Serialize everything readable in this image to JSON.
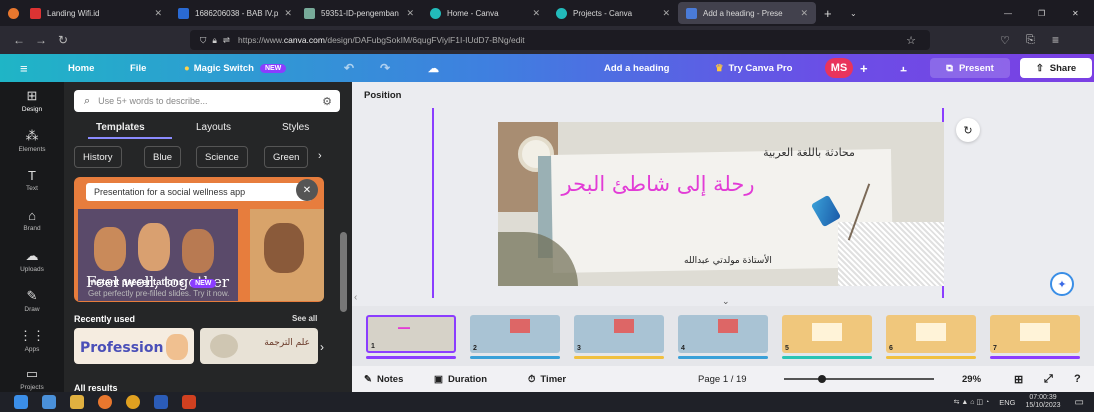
{
  "browser": {
    "tabs": [
      {
        "title": "Landing Wifi.id",
        "color": "#d33"
      },
      {
        "title": "1686206038 - BAB IV.p",
        "color": "#2a6ad4"
      },
      {
        "title": "59351-ID-pengemban",
        "color": "#7a9"
      },
      {
        "title": "Home - Canva",
        "color": "#2bb"
      },
      {
        "title": "Projects - Canva",
        "color": "#2bb"
      },
      {
        "title": "Add a heading - Prese",
        "color": "#4a7bd8"
      }
    ],
    "url_prefix": "https://www.",
    "url_domain": "canva.com",
    "url_path": "/design/DAFubgSokIM/6qugFViylF1I-IUdD7-BNg/edit"
  },
  "canva": {
    "home": "Home",
    "file": "File",
    "magic_switch": "Magic Switch",
    "new_badge": "NEW",
    "doc_title": "Add a heading",
    "try_pro": "Try Canva Pro",
    "avatar": "MS",
    "present": "Present",
    "share": "Share"
  },
  "rail": [
    {
      "label": "Design",
      "icon": "design-icon",
      "glyph": "⊞"
    },
    {
      "label": "Elements",
      "icon": "elements-icon",
      "glyph": "⁂"
    },
    {
      "label": "Text",
      "icon": "text-icon",
      "glyph": "T"
    },
    {
      "label": "Brand",
      "icon": "brand-icon",
      "glyph": "⌂"
    },
    {
      "label": "Uploads",
      "icon": "uploads-icon",
      "glyph": "☁"
    },
    {
      "label": "Draw",
      "icon": "draw-icon",
      "glyph": "✎"
    },
    {
      "label": "Apps",
      "icon": "apps-icon",
      "glyph": "⋮⋮"
    },
    {
      "label": "Projects",
      "icon": "projects-icon",
      "glyph": "▭"
    }
  ],
  "panel": {
    "search_placeholder": "Use 5+ words to describe...",
    "tabs": [
      "Templates",
      "Layouts",
      "Styles"
    ],
    "chips": [
      "History",
      "Blue",
      "Science",
      "Green"
    ],
    "hero_prompt": "Presentation for a social wellness app",
    "hero_caption": "Feel well, together",
    "hero_title": "Instant presentations",
    "hero_badge": "NEW",
    "hero_sub": "Get perfectly pre-filled slides. Try it now.",
    "recently_used": "Recently used",
    "see_all": "See all",
    "recent_1_title": "Profession",
    "recent_2_title": "علم الترجمة",
    "all_results": "All results"
  },
  "editor": {
    "position": "Position",
    "slide_title": "رحلة إلى شاطئ البحر",
    "slide_subtitle": "محادثة باللغة العربية",
    "slide_author": "الأستاذة مولدتي عبدالله"
  },
  "filmstrip": {
    "numbers": [
      "1",
      "2",
      "3",
      "4",
      "5",
      "6",
      "7"
    ]
  },
  "bottom": {
    "notes": "Notes",
    "duration": "Duration",
    "timer": "Timer",
    "page": "Page 1 / 19",
    "zoom": "29%"
  },
  "taskbar": {
    "lang": "ENG",
    "time": "07:00:39",
    "date": "15/10/2023"
  }
}
